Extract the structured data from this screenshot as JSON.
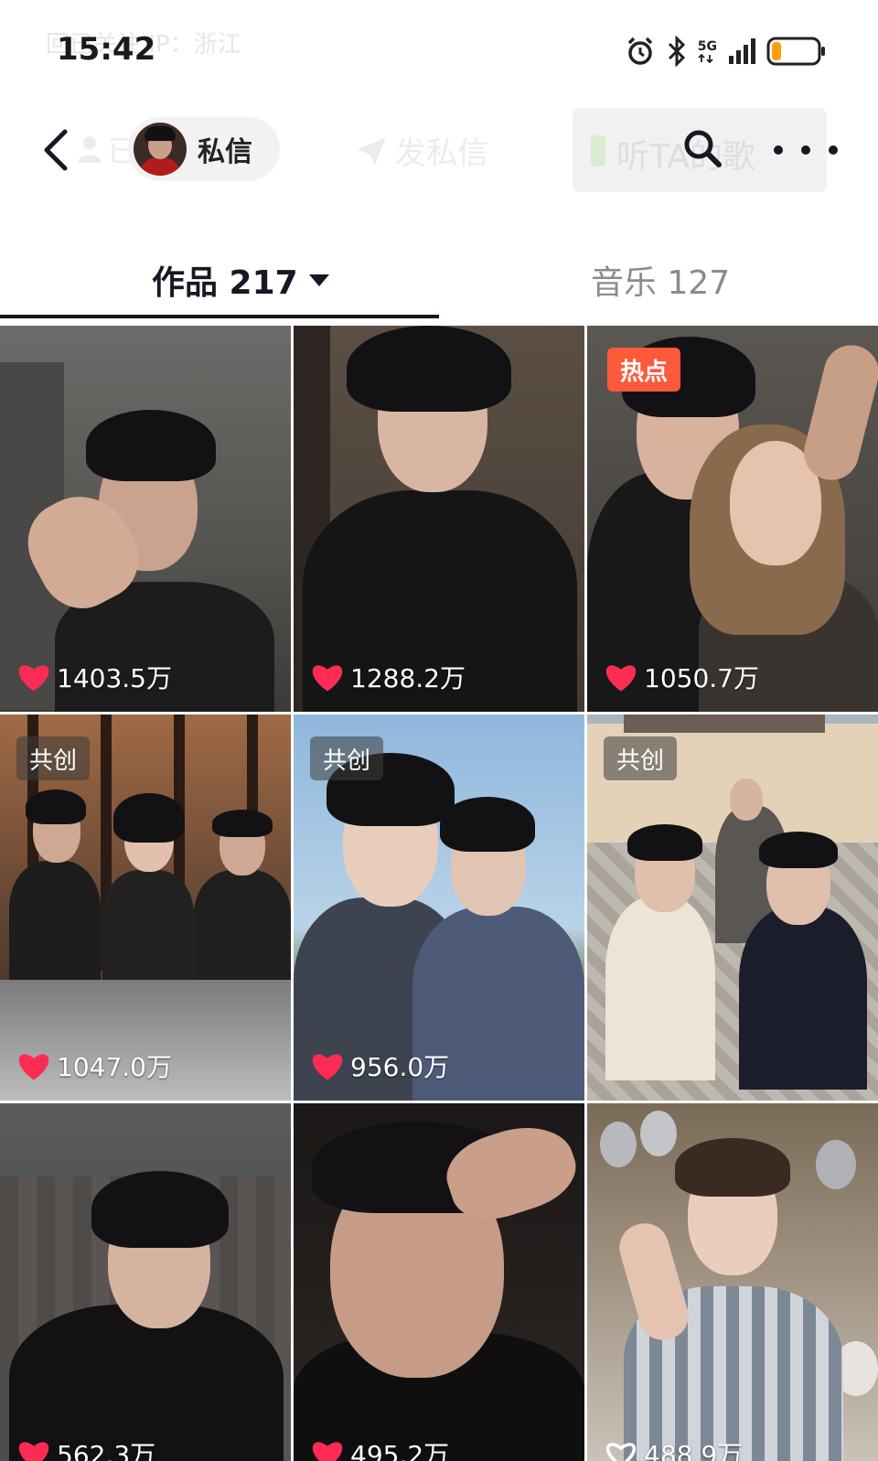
{
  "status_bar": {
    "time": "15:42",
    "ghost_text": "回已关注  IP：浙江",
    "network": "5G",
    "icons": [
      "alarm-icon",
      "bluetooth-icon",
      "signal-icon",
      "battery-icon"
    ],
    "battery_level": 0.2
  },
  "nav": {
    "ghost_follow": "已关注",
    "dm_label": "私信",
    "ghost_send": "发私信",
    "ghost_listen": "听TA的歌"
  },
  "tabs": {
    "works_label": "作品 217",
    "music_label": "音乐 127"
  },
  "posts": [
    {
      "likes": "1403.5万",
      "tag": ""
    },
    {
      "likes": "1288.2万",
      "tag": ""
    },
    {
      "likes": "1050.7万",
      "tag": "热点"
    },
    {
      "likes": "1047.0万",
      "tag": "共创"
    },
    {
      "likes": "956.0万",
      "tag": "共创"
    },
    {
      "likes": "",
      "tag": "共创"
    },
    {
      "likes": "562.3万",
      "tag": ""
    },
    {
      "likes": "495.2万",
      "tag": ""
    },
    {
      "likes": "488.9万",
      "tag": ""
    }
  ],
  "colors": {
    "accent_red": "#fe2c55",
    "hot_tag": "#fd5a3c",
    "tab_active": "#161823",
    "tab_inactive": "#8a8b91"
  }
}
